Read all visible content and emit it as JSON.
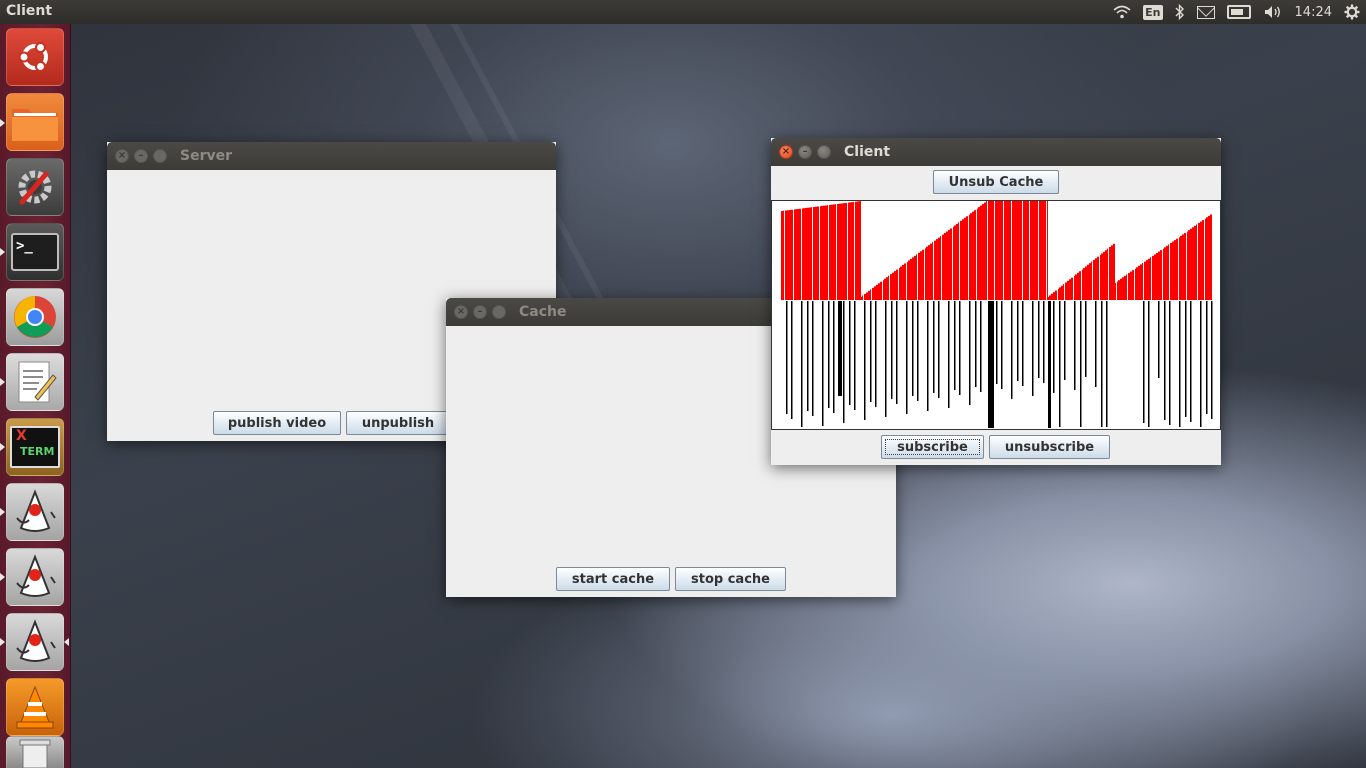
{
  "top_panel": {
    "app_title": "Client",
    "keyboard_layout": "En",
    "time": "14:24",
    "icons": [
      "wifi-icon",
      "keyboard-icon",
      "bluetooth-icon",
      "mail-icon",
      "battery-icon",
      "volume-icon",
      "gear-icon"
    ]
  },
  "launcher": {
    "items": [
      {
        "name": "ubuntu-dash",
        "icon": "ubuntu-logo-icon"
      },
      {
        "name": "files",
        "icon": "folder-icon"
      },
      {
        "name": "system-settings",
        "icon": "settings-icon"
      },
      {
        "name": "terminal",
        "icon": "terminal-icon",
        "glyph": ">_"
      },
      {
        "name": "chrome",
        "icon": "chrome-icon"
      },
      {
        "name": "text-editor",
        "icon": "text-editor-icon"
      },
      {
        "name": "xterm",
        "icon": "xterm-icon",
        "label_x": "X",
        "label_term": "TERM"
      },
      {
        "name": "java-app-1",
        "icon": "java-duke-icon"
      },
      {
        "name": "java-app-2",
        "icon": "java-duke-icon"
      },
      {
        "name": "java-app-3",
        "icon": "java-duke-icon"
      },
      {
        "name": "vlc",
        "icon": "vlc-cone-icon"
      },
      {
        "name": "trash",
        "icon": "trash-icon"
      }
    ]
  },
  "windows": {
    "server": {
      "title": "Server",
      "buttons": {
        "publish": "publish video",
        "unpublish": "unpublish"
      }
    },
    "cache": {
      "title": "Cache",
      "buttons": {
        "start": "start cache",
        "stop": "stop cache"
      }
    },
    "client": {
      "title": "Client",
      "buttons": {
        "unsub_cache": "Unsub Cache",
        "subscribe": "subscribe",
        "unsubscribe": "unsubscribe"
      }
    }
  },
  "colors": {
    "panel_bg": "#3c3b37",
    "launcher_bg": "#6b2233",
    "window_bg": "#eeeeee",
    "bar_red": "#ff0000",
    "bar_black": "#000000"
  }
}
